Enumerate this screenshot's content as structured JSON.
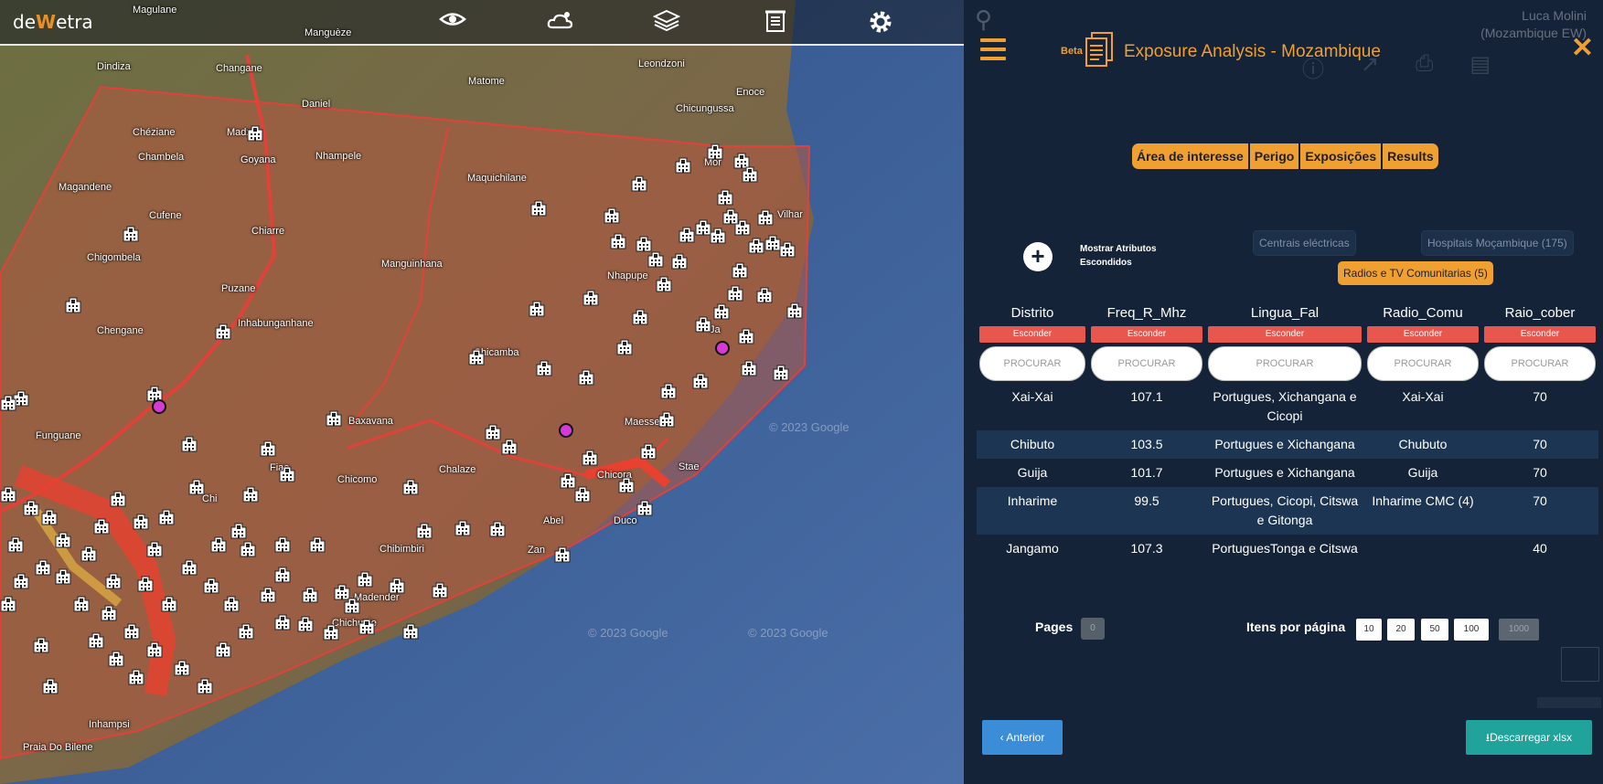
{
  "app": {
    "logo_prefix": "de",
    "logo_w": "W",
    "logo_suffix": "etra"
  },
  "toolbar": {
    "icons": [
      "eye-icon",
      "weather-icon",
      "layers-icon",
      "report-icon",
      "gear-icon"
    ]
  },
  "map": {
    "places": [
      "Magulane",
      "Manguèze",
      "Dindiza",
      "Changane",
      "Daniel",
      "Matome",
      "Leondzoni",
      "Enoce",
      "Chicungussa",
      "Chéziane",
      "Madze",
      "Chambela",
      "Goyana",
      "Nhampele",
      "Magandene",
      "Maquichilane",
      "Cufene",
      "Chigombela",
      "Chiarre",
      "Manguinhana",
      "Puzane",
      "Nhapupe",
      "Chengane",
      "Inhabunganhane",
      "Chicamba",
      "Funguane",
      "Baxavana",
      "Chalaze",
      "Chicomo",
      "Maesse",
      "Chicora",
      "Abel",
      "Duco",
      "Chibimbiri",
      "Madender",
      "Chichuele",
      "Inhampsi",
      "Praia Do Bilene",
      "Fiae",
      "Stae",
      "Zan",
      "Chi",
      "Ja",
      "Mor",
      "Vilhar"
    ],
    "copyright": "© 2023 Google"
  },
  "panel": {
    "ghost_user_name": "Luca Molini",
    "ghost_user_role": "(Mozambique EW)",
    "beta_label": "Beta v.",
    "title": "Exposure Analysis - Mozambique",
    "close_label": "✕",
    "steps": [
      "Área de interesse",
      "Perigo",
      "Exposições",
      "Results"
    ],
    "show_hidden_line1": "Mostrar Atributos",
    "show_hidden_line2": "Escondidos",
    "layers": {
      "power": "Centrais eléctricas",
      "hospitals": "Hospitais Moçambique (175)",
      "radios": "Radios e TV Comunitarias (5)"
    },
    "table": {
      "columns": [
        "Distrito",
        "Freq_R_Mhz",
        "Lingua_Fal",
        "Radio_Comu",
        "Raio_cober"
      ],
      "hide_label": "Esconder",
      "search_placeholder": "PROCURAR",
      "rows": [
        [
          "Xai-Xai",
          "107.1",
          "Portugues, Xichangana e Cicopi",
          "Xai-Xai",
          "70"
        ],
        [
          "Chibuto",
          "103.5",
          "Portugues e Xichangana",
          "Chubuto",
          "70"
        ],
        [
          "Guija",
          "101.7",
          "Portugues e Xichangana",
          "Guija",
          "70"
        ],
        [
          "Inharime",
          "99.5",
          "Portugues, Cicopi, Citswa e Gitonga",
          "Inharime CMC (4)",
          "70"
        ],
        [
          "Jangamo",
          "107.3",
          "PortuguesTonga e Citswa",
          "",
          "40"
        ]
      ]
    },
    "pagination": {
      "pages_label": "Pages",
      "current_page": "0",
      "items_per_page_label": "Itens por página",
      "options": [
        "10",
        "20",
        "50",
        "100",
        "1000"
      ],
      "selected": "1000"
    },
    "prev_label": "‹ Anterior",
    "download_label": "⭳Descarregar xlsx"
  }
}
